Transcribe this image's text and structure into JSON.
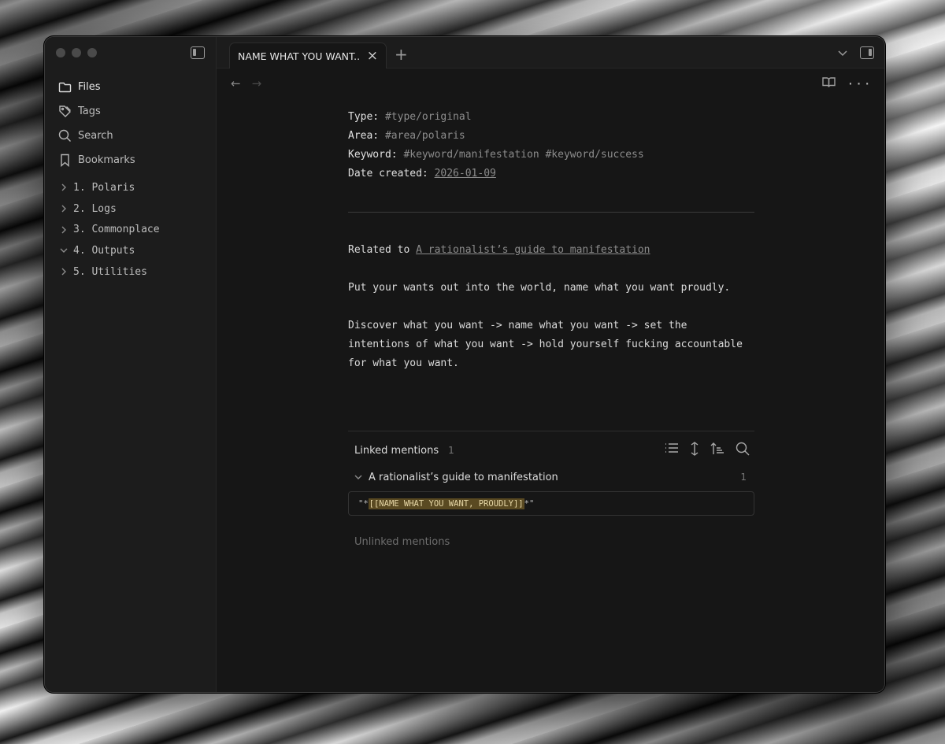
{
  "window": {
    "tab": {
      "title": "NAME WHAT YOU WANT...",
      "close_icon": "×",
      "add_icon": "+"
    }
  },
  "sidebar": {
    "nav": [
      {
        "label": "Files",
        "icon": "folder-icon"
      },
      {
        "label": "Tags",
        "icon": "tag-icon"
      },
      {
        "label": "Search",
        "icon": "search-icon"
      },
      {
        "label": "Bookmarks",
        "icon": "bookmark-icon"
      }
    ],
    "tree": [
      {
        "label": "1. Polaris",
        "expanded": false
      },
      {
        "label": "2. Logs",
        "expanded": false
      },
      {
        "label": "3. Commonplace",
        "expanded": false
      },
      {
        "label": "4. Outputs",
        "expanded": true
      },
      {
        "label": "5. Utilities",
        "expanded": false
      }
    ]
  },
  "content": {
    "nav_back": "←",
    "nav_forward": "→",
    "more": "···",
    "properties": {
      "type": {
        "key": "Type:",
        "value": "#type/original"
      },
      "area": {
        "key": "Area:",
        "value": "#area/polaris"
      },
      "keyword": {
        "key": "Keyword:",
        "values": [
          "#keyword/manifestation",
          "#keyword/success"
        ]
      },
      "date_created": {
        "key": "Date created:",
        "value": "2026-01-09"
      }
    },
    "related": {
      "prefix": "Related to ",
      "link": "A rationalist’s guide to manifestation"
    },
    "paragraphs": [
      "Put your wants out into the world, name what you want proudly.",
      "Discover what you want -> name what you want -> set the intentions of what you want -> hold yourself fucking accountable for what you want."
    ]
  },
  "backlinks": {
    "title": "Linked mentions",
    "count": "1",
    "file": {
      "name": "A rationalist’s guide to manifestation",
      "count": "1"
    },
    "snippet": {
      "prefix": "\"*",
      "highlight": "[[NAME WHAT YOU WANT, PROUDLY]]",
      "suffix": "*\""
    },
    "unlinked": "Unlinked mentions"
  }
}
